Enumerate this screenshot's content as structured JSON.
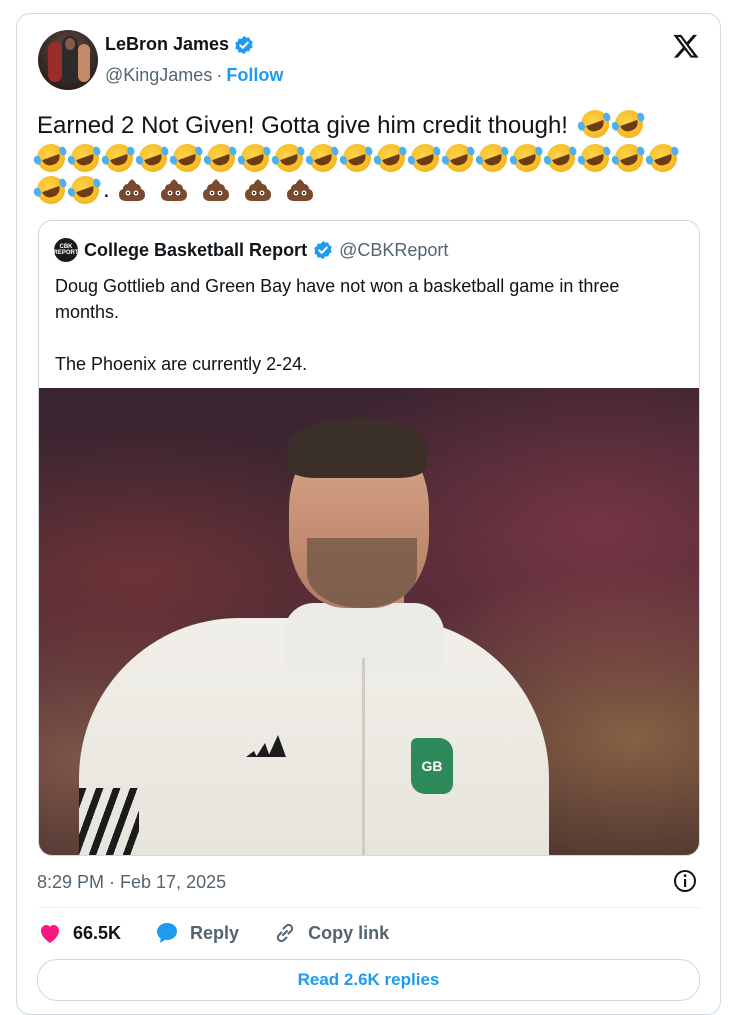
{
  "author": {
    "name": "LeBron James",
    "handle": "@KingJames",
    "separator": "·",
    "follow_label": "Follow"
  },
  "tweet": {
    "text": "Earned 2 Not Given! Gotta give him credit though!",
    "trailing_dot": ".",
    "emoji_line1": "rolling-on-floor-laughing x2",
    "emoji_line2_count": 19,
    "emoji_line3": "rolling-on-floor-laughing x2, pile-of-poo x5"
  },
  "quoted": {
    "name": "College Basketball Report",
    "handle": "@CBKReport",
    "avatar_text": "CBK REPORT",
    "paragraph1": "Doug Gottlieb and Green Bay have not won a basketball game in three months.",
    "paragraph2": "The Phoenix are currently 2-24.",
    "photo_logo_text": "GB"
  },
  "meta": {
    "timestamp": "8:29 PM · Feb 17, 2025"
  },
  "actions": {
    "like_count": "66.5K",
    "reply_label": "Reply",
    "copy_link_label": "Copy link"
  },
  "read_replies_label": "Read 2.6K replies",
  "colors": {
    "accent": "#1d9bf0",
    "like_heart": "#f91880",
    "text_primary": "#0f1419",
    "text_secondary": "#536471",
    "border": "#cfd9de"
  }
}
